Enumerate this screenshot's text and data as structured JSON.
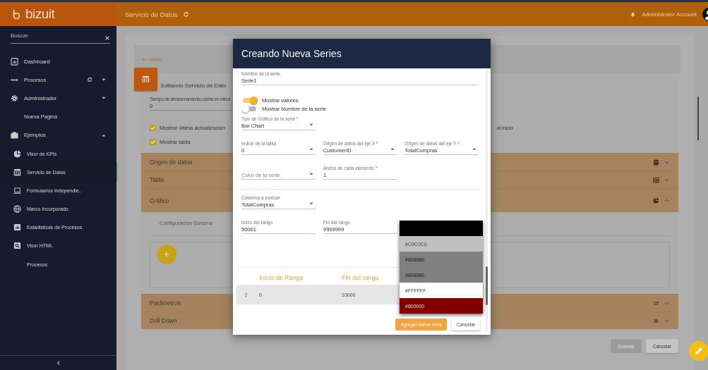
{
  "header": {
    "logo": "bizuit",
    "title": "Servicio de Datos",
    "user": "Administrator Account"
  },
  "sidebar": {
    "search": {
      "placeholder": "Buscar"
    },
    "items": [
      {
        "label": "Dashboard",
        "selected": false
      },
      {
        "label": "Procesos",
        "selected": false,
        "expanded": false
      },
      {
        "label": "Administrador",
        "selected": false,
        "expanded": false
      },
      {
        "label": "Nueva Pagina",
        "selected": false
      },
      {
        "label": "Ejemplos",
        "selected": false,
        "expanded": true,
        "children": [
          {
            "label": "Visor de KPIs",
            "selected": false
          },
          {
            "label": "Servicio de Datos",
            "selected": true
          },
          {
            "label": "Formularios Independie..",
            "selected": false
          },
          {
            "label": "Marco Incorporado",
            "selected": false
          },
          {
            "label": "Estadisticas de Procesos",
            "selected": false
          },
          {
            "label": "Visor HTML",
            "selected": false
          },
          {
            "label": "Procesos",
            "selected": false
          }
        ]
      }
    ]
  },
  "page": {
    "back": "Volver",
    "title": "Editando Servicio de Dato",
    "cache": {
      "label": "Tiempo de almacenamiento cache en minut",
      "value": "0"
    },
    "checks": [
      {
        "label": "Mostrar última actualizacion",
        "checked": true
      },
      {
        "label": "Mostrar tabla",
        "checked": true
      }
    ],
    "side_text": "al inicio",
    "sections_top": [
      {
        "title": "Origen de datos",
        "expanded": false
      },
      {
        "title": "Tabla",
        "expanded": false
      },
      {
        "title": "Gráfico",
        "expanded": true
      }
    ],
    "tabs": [
      {
        "label": "Configuración General",
        "selected": false
      }
    ],
    "sections_bottom": [
      {
        "title": "Parámetros",
        "expanded": false
      },
      {
        "title": "Drill Down",
        "expanded": false
      }
    ],
    "buttons": [
      {
        "label": "Guardar",
        "disabled": true
      },
      {
        "label": "Cancelar",
        "disabled": false
      }
    ]
  },
  "modal": {
    "title": "Creando Nueva Series",
    "name_field": {
      "label": "Nombre de la serie",
      "value": "Serie1"
    },
    "toggles": [
      {
        "label": "Mostrar valores",
        "on": true
      },
      {
        "label": "Mostrar Nombre de la serie",
        "on": false
      }
    ],
    "field_rows": [
      [
        {
          "kind": "select",
          "label": "Tipo de Gráfico de la serie *",
          "value": "Bar Chart"
        }
      ],
      [
        {
          "kind": "select",
          "label": "Indice de la tabla",
          "value": "0"
        },
        {
          "kind": "select",
          "label": "Origen de datos del eje X *",
          "value": "CustomerID"
        },
        {
          "kind": "select",
          "label": "Origen de datos del eje Y *",
          "value": "TotalCompras"
        }
      ],
      [
        {
          "kind": "select",
          "placeholder": "Color de la serie"
        },
        {
          "kind": "text",
          "label": "Ancho de cada elemento *",
          "value": "1"
        }
      ],
      [
        {
          "kind": "select",
          "label": "Columna a evaluar",
          "value": "TotalCompras"
        }
      ],
      [
        {
          "kind": "text",
          "label": "Inicio del rango",
          "value": "50001"
        },
        {
          "kind": "text",
          "label": "Fin del rango",
          "value": "9999999"
        }
      ]
    ],
    "range_table": {
      "columns": [
        "Inicio de Rango",
        "Fin del rango"
      ],
      "rows": [
        [
          "0",
          "10000"
        ]
      ]
    },
    "color_options": [
      {
        "color": "#000000"
      },
      {
        "label": "#C0C0C0",
        "color": "#c0c0c0"
      },
      {
        "label": "#808080",
        "color": "#808080"
      },
      {
        "label": "#808080",
        "color": "#808080"
      },
      {
        "label": "#FFFFFF",
        "color": "#ffffff"
      },
      {
        "label": "#800000",
        "color": "#800000"
      }
    ],
    "buttons": [
      {
        "label": "Agregar nueva serie",
        "kind": "primary"
      },
      {
        "label": "Cancelar",
        "kind": "secondary"
      }
    ]
  }
}
